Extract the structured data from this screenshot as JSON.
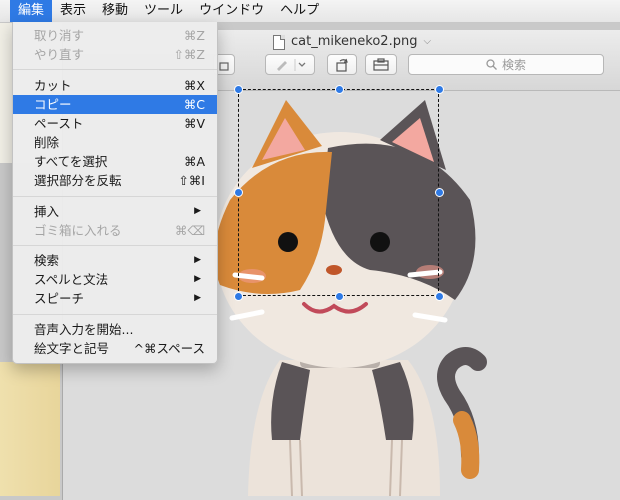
{
  "menubar": {
    "items": [
      "編集",
      "表示",
      "移動",
      "ツール",
      "ウインドウ",
      "ヘルプ"
    ],
    "active_index": 0
  },
  "window": {
    "title": "cat_mikeneko2.png",
    "search_placeholder": "検索"
  },
  "edit_menu": {
    "items": [
      {
        "label": "取り消す",
        "shortcut": "⌘Z",
        "disabled": true
      },
      {
        "label": "やり直す",
        "shortcut": "⇧⌘Z",
        "disabled": true
      },
      {
        "label": "カット",
        "shortcut": "⌘X"
      },
      {
        "label": "コピー",
        "shortcut": "⌘C",
        "highlighted": true
      },
      {
        "label": "ペースト",
        "shortcut": "⌘V"
      },
      {
        "label": "削除",
        "shortcut": ""
      },
      {
        "label": "すべてを選択",
        "shortcut": "⌘A"
      },
      {
        "label": "選択部分を反転",
        "shortcut": "⇧⌘I"
      },
      {
        "label": "挿入",
        "submenu": true
      },
      {
        "label": "ゴミ箱に入れる",
        "shortcut": "⌘⌫",
        "disabled": true
      },
      {
        "label": "検索",
        "submenu": true
      },
      {
        "label": "スペルと文法",
        "submenu": true
      },
      {
        "label": "スピーチ",
        "submenu": true
      },
      {
        "label": "音声入力を開始...",
        "shortcut": ""
      },
      {
        "label": "絵文字と記号",
        "shortcut": "^⌘スペース"
      }
    ]
  },
  "colors": {
    "accent": "#2f7ae5",
    "cat_orange": "#d98a3a",
    "cat_gray": "#5a5457",
    "cat_white": "#f0e8e0"
  }
}
